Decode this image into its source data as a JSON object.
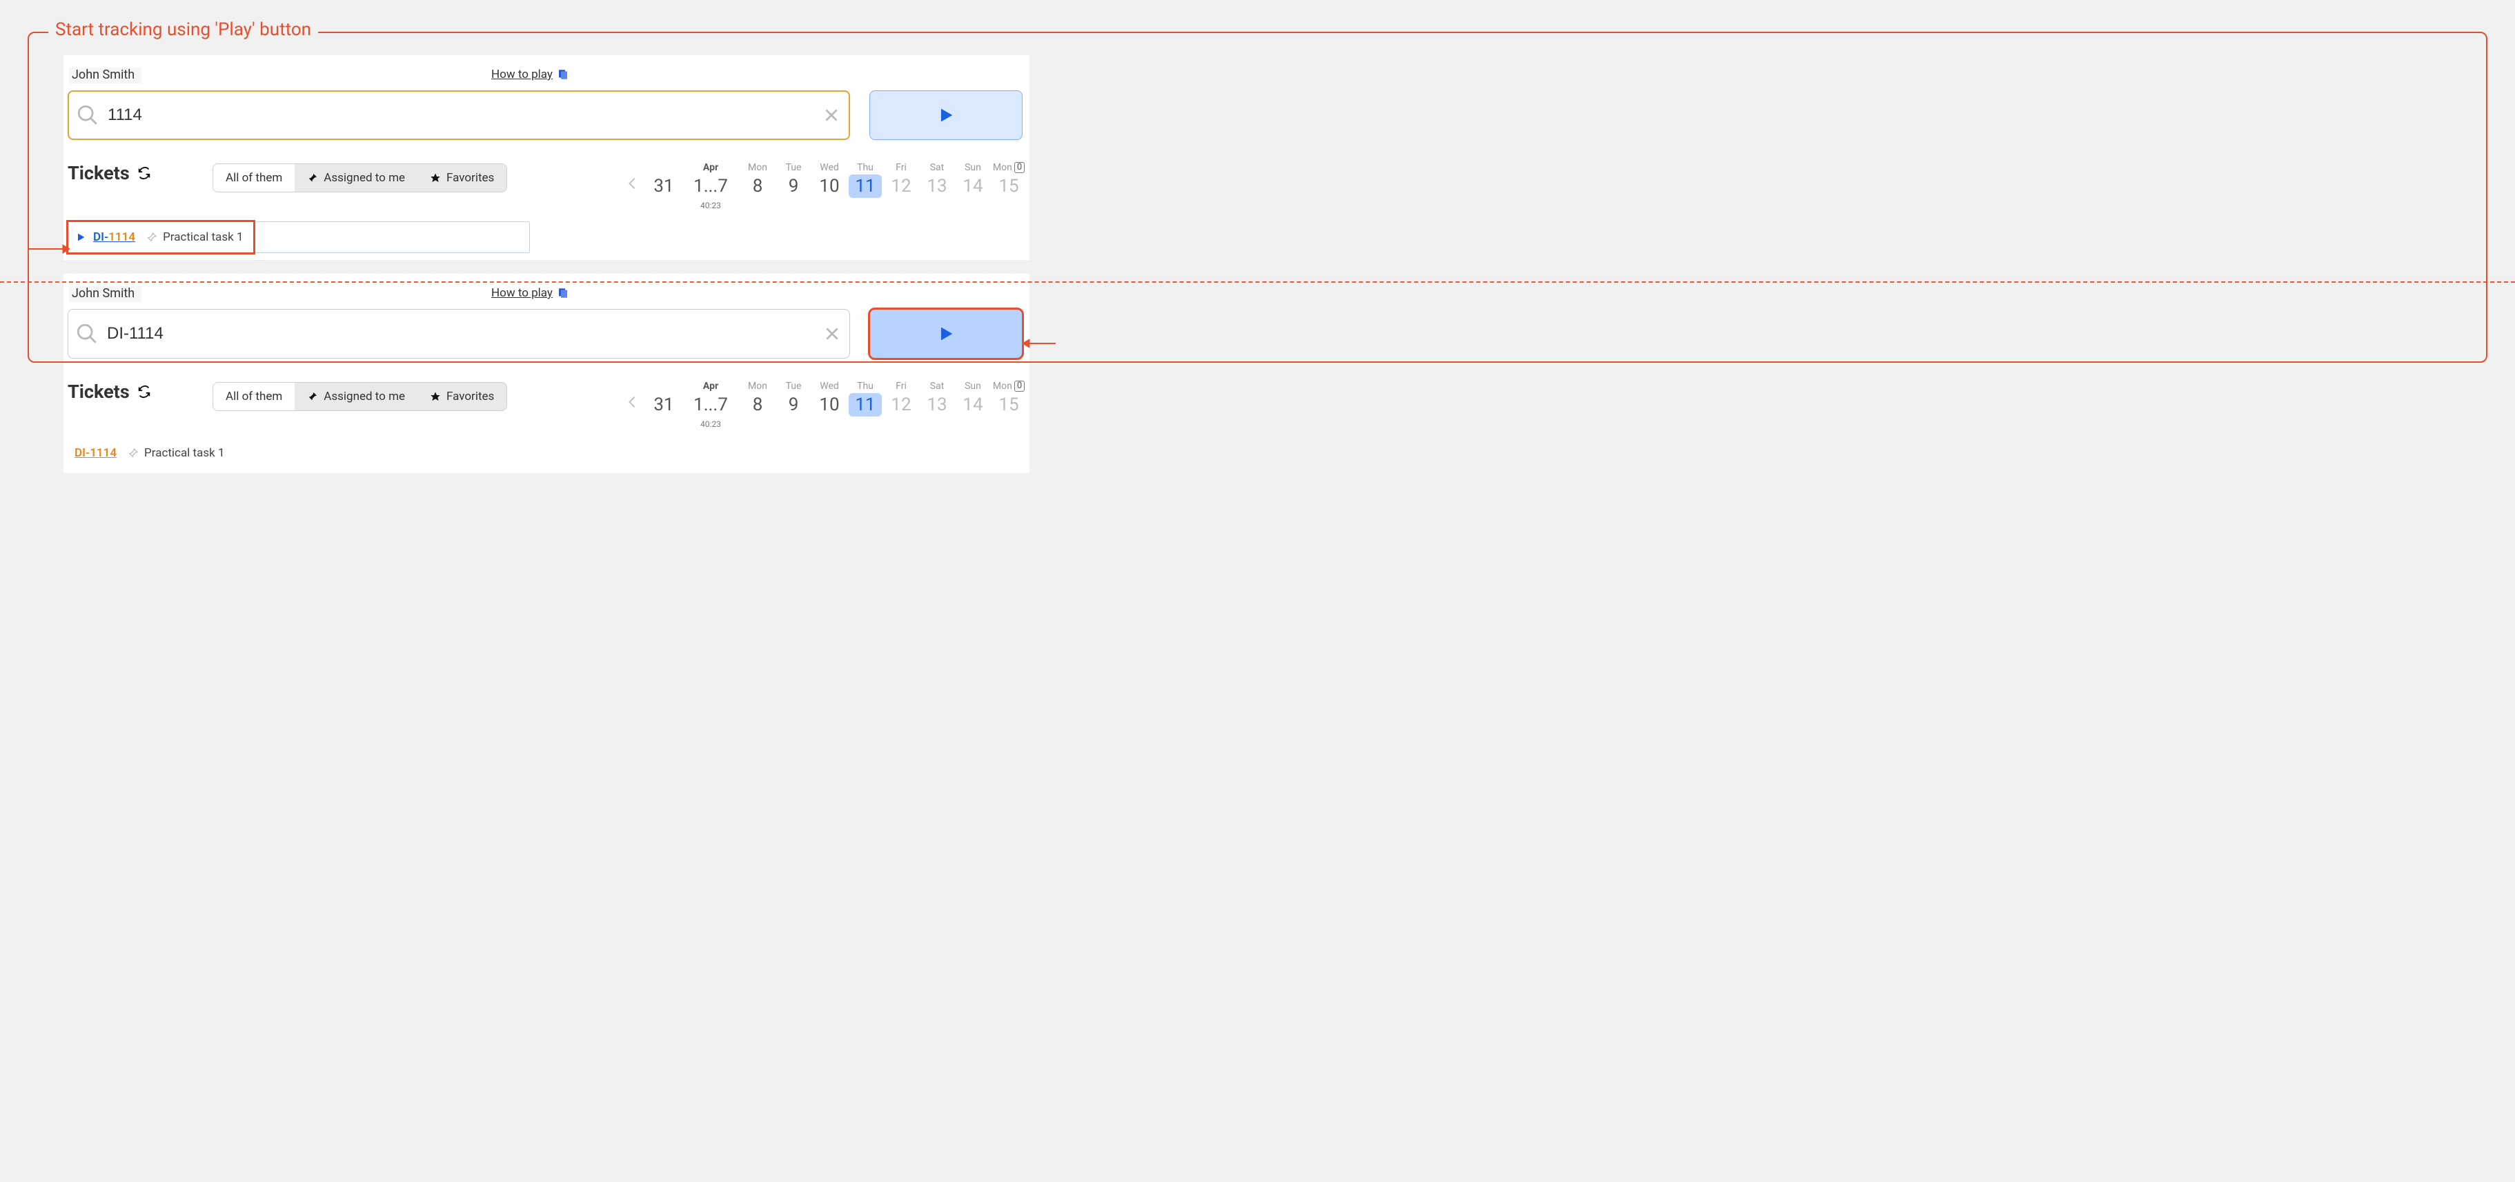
{
  "annotation_title": "Start tracking using 'Play' button",
  "user_name": "John Smith",
  "how_to_play": "How to play",
  "search": {
    "value_top": "1114",
    "value_bottom": "DI-1114"
  },
  "tickets_heading": "Tickets",
  "filters": {
    "all": "All of them",
    "assigned": "Assigned to me",
    "favorites": "Favorites"
  },
  "calendar": {
    "prev_month_day": "31",
    "month_label": "Apr",
    "week_range": "1...7",
    "week_time": "40:23",
    "days": [
      {
        "dow": "Mon",
        "date": "8",
        "muted": false,
        "selected": false
      },
      {
        "dow": "Tue",
        "date": "9",
        "muted": false,
        "selected": false
      },
      {
        "dow": "Wed",
        "date": "10",
        "muted": false,
        "selected": false
      },
      {
        "dow": "Thu",
        "date": "11",
        "muted": false,
        "selected": true
      },
      {
        "dow": "Fri",
        "date": "12",
        "muted": true,
        "selected": false
      },
      {
        "dow": "Sat",
        "date": "13",
        "muted": true,
        "selected": false
      },
      {
        "dow": "Sun",
        "date": "14",
        "muted": true,
        "selected": false
      }
    ],
    "next_dow": "Mon",
    "next_date": "15",
    "zero_badge": "0"
  },
  "ticket": {
    "prefix": "DI-",
    "match": "1114",
    "full_id": "DI-1114",
    "title": "Practical task 1"
  }
}
